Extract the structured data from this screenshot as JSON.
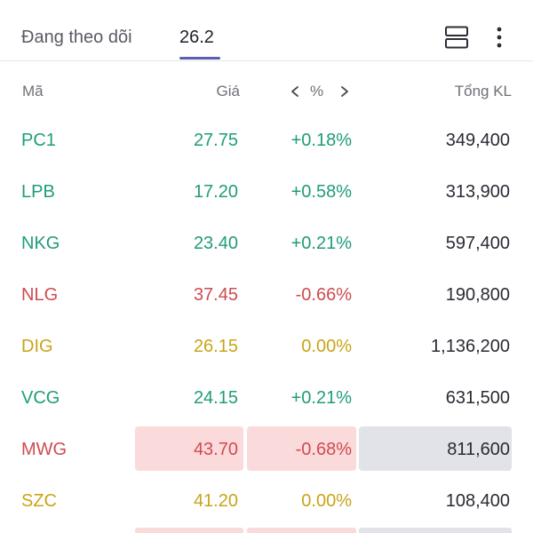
{
  "tabs": {
    "watchlist_label": "Đang theo dõi",
    "date_label": "26.2"
  },
  "icons": {
    "layout": "layout-split-icon",
    "more": "more-vertical-icon"
  },
  "colors": {
    "up": "#1f9c7a",
    "down": "#cf4b50",
    "reference": "#c9a416",
    "accent": "#5b5fae",
    "highlight_red": "#fbdadb",
    "highlight_gray": "#e2e3e8"
  },
  "columns": {
    "symbol": "Mã",
    "price": "Giá",
    "percent": "%",
    "volume": "Tổng KL"
  },
  "rows": [
    {
      "symbol": "PC1",
      "price": "27.75",
      "change": "+0.18%",
      "volume": "349,400",
      "trend": "up"
    },
    {
      "symbol": "LPB",
      "price": "17.20",
      "change": "+0.58%",
      "volume": "313,900",
      "trend": "up"
    },
    {
      "symbol": "NKG",
      "price": "23.40",
      "change": "+0.21%",
      "volume": "597,400",
      "trend": "up"
    },
    {
      "symbol": "NLG",
      "price": "37.45",
      "change": "-0.66%",
      "volume": "190,800",
      "trend": "down"
    },
    {
      "symbol": "DIG",
      "price": "26.15",
      "change": "0.00%",
      "volume": "1,136,200",
      "trend": "ref"
    },
    {
      "symbol": "VCG",
      "price": "24.15",
      "change": "+0.21%",
      "volume": "631,500",
      "trend": "up"
    },
    {
      "symbol": "MWG",
      "price": "43.70",
      "change": "-0.68%",
      "volume": "811,600",
      "trend": "down",
      "highlighted": true
    },
    {
      "symbol": "SZC",
      "price": "41.20",
      "change": "0.00%",
      "volume": "108,400",
      "trend": "ref"
    }
  ]
}
